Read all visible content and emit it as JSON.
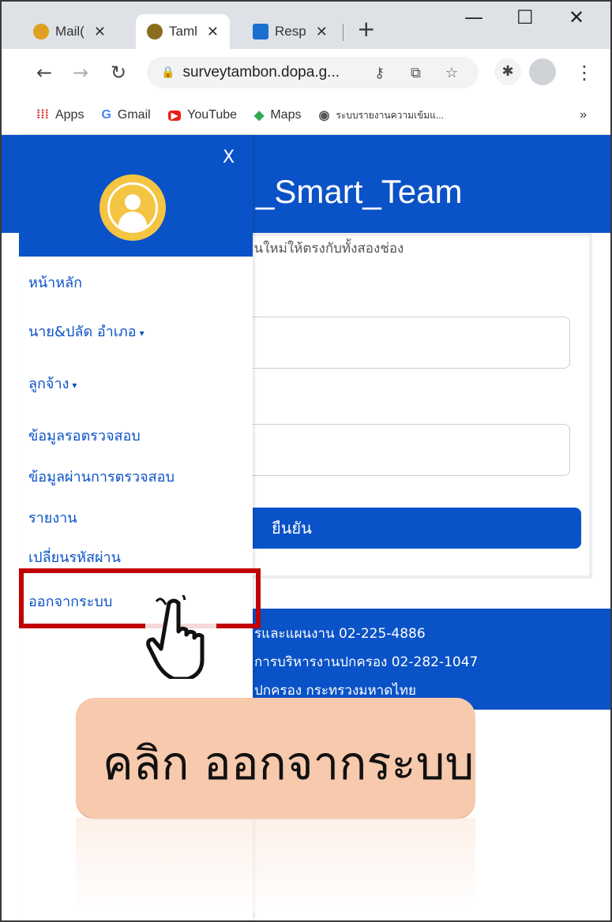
{
  "tabs": [
    {
      "label": "Mail(",
      "icon": "mail-icon"
    },
    {
      "label": "Taml",
      "icon": "tambon-icon"
    },
    {
      "label": "Resp",
      "icon": "response-icon"
    }
  ],
  "address_bar": {
    "url": "surveytambon.dopa.g..."
  },
  "bookmarks": [
    {
      "label": "Apps",
      "icon": "apps-icon"
    },
    {
      "label": "Gmail",
      "icon": "gmail-icon"
    },
    {
      "label": "YouTube",
      "icon": "youtube-icon"
    },
    {
      "label": "Maps",
      "icon": "maps-icon"
    },
    {
      "label": "ระบบรายงานความเข้มแ...",
      "icon": "web-icon"
    }
  ],
  "bookmarks_more": "»",
  "page": {
    "header_title": "_Smart_Team",
    "hint_text": "ผ่านใหม่ให้ตรงกับทั้งสองช่อง",
    "submit_label": "ยืนยัน",
    "footer_lines": [
      "รและแผนงาน 02-225-4886",
      "การบริหารงานปกครอง 02-282-1047",
      "ปกครอง กระทรวงมหาดไทย"
    ]
  },
  "sidebar": {
    "close_label": "X",
    "items": [
      {
        "label": "หน้าหลัก",
        "has_caret": false
      },
      {
        "label": "นาย&ปลัด อำเภอ",
        "has_caret": true
      },
      {
        "label": "ลูกจ้าง",
        "has_caret": true
      },
      {
        "label": "ข้อมูลรอตรวจสอบ",
        "has_caret": false
      },
      {
        "label": "ข้อมูลผ่านการตรวจสอบ",
        "has_caret": false
      },
      {
        "label": "รายงาน",
        "has_caret": false
      },
      {
        "label": "เปลี่ยนรหัสผ่าน",
        "has_caret": false
      },
      {
        "label": "ออกจากระบบ",
        "has_caret": false
      }
    ],
    "caret_glyph": "▾"
  },
  "callout": {
    "text": "คลิก ออกจากระบบ"
  },
  "colors": {
    "brand_blue": "#0a52c7",
    "highlight_red": "#c00000",
    "callout_bg": "#f7c9ad",
    "avatar_yellow": "#f4c542"
  }
}
